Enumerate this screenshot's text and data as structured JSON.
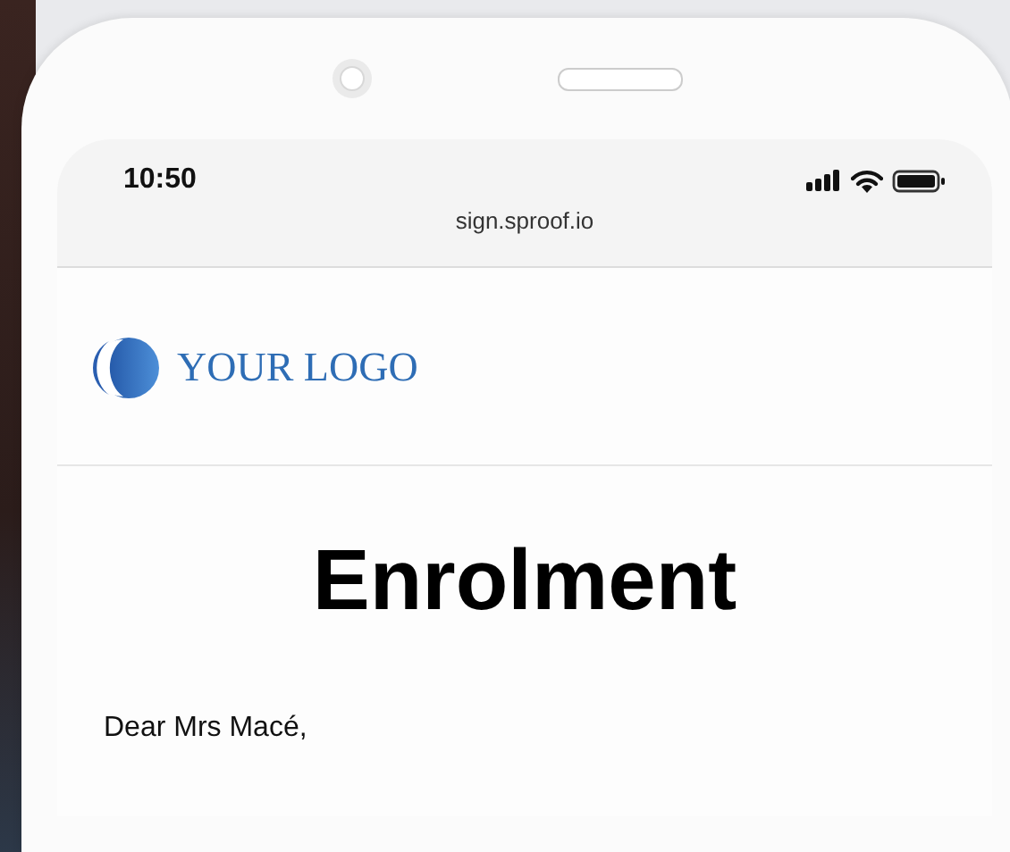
{
  "status_bar": {
    "time": "10:50"
  },
  "address_bar": {
    "url": "sign.sproof.io"
  },
  "page": {
    "logo_text": "YOUR LOGO",
    "heading": "Enrolment",
    "greeting": "Dear Mrs Macé,"
  }
}
